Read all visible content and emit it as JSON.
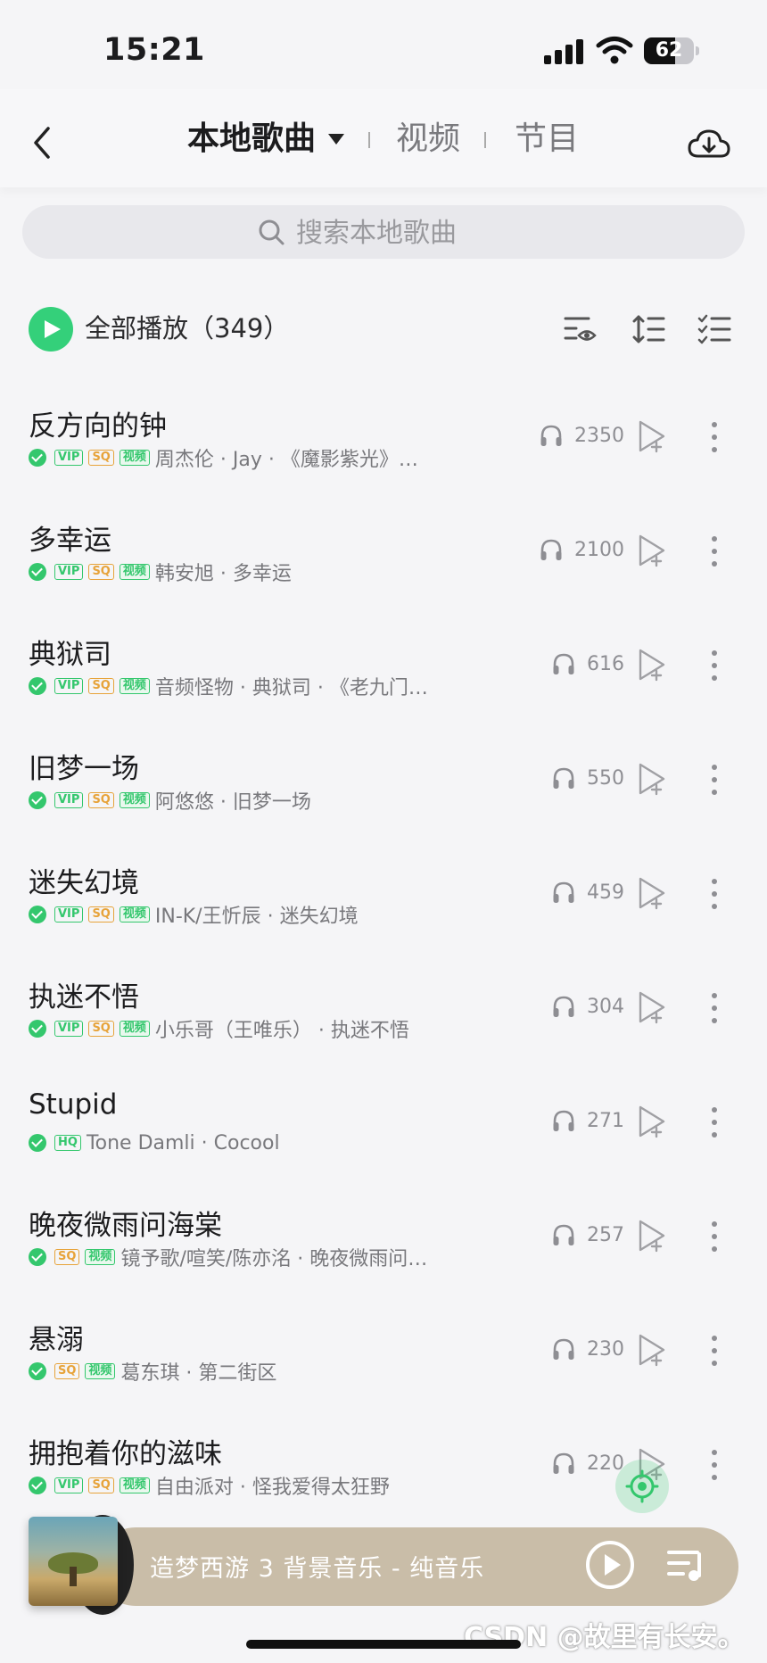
{
  "status": {
    "time": "15:21",
    "battery": "62",
    "battery_level": 0.62
  },
  "header": {
    "tabs": [
      {
        "label": "本地歌曲",
        "active": true
      },
      {
        "label": "视频",
        "active": false
      },
      {
        "label": "节目",
        "active": false
      }
    ],
    "icons": [
      "chevron-left-icon",
      "cloud-download-icon"
    ]
  },
  "search": {
    "placeholder": "搜索本地歌曲"
  },
  "toolbar": {
    "play_all_label": "全部播放（349）"
  },
  "songs": [
    {
      "title": "反方向的钟",
      "badges": [
        "VIP",
        "SQ",
        "视频"
      ],
      "subtitle": "周杰伦 · Jay · 《魔影紫光》…",
      "plays": "2350"
    },
    {
      "title": "多幸运",
      "badges": [
        "VIP",
        "SQ",
        "视频"
      ],
      "subtitle": "韩安旭 · 多幸运",
      "plays": "2100"
    },
    {
      "title": "典狱司",
      "badges": [
        "VIP",
        "SQ",
        "视频"
      ],
      "subtitle": "音频怪物 · 典狱司 · 《老九门…",
      "plays": "616"
    },
    {
      "title": "旧梦一场",
      "badges": [
        "VIP",
        "SQ",
        "视频"
      ],
      "subtitle": "阿悠悠 · 旧梦一场",
      "plays": "550"
    },
    {
      "title": "迷失幻境",
      "badges": [
        "VIP",
        "SQ",
        "视频"
      ],
      "subtitle": "IN-K/王忻辰 · 迷失幻境",
      "plays": "459"
    },
    {
      "title": "执迷不悟",
      "badges": [
        "VIP",
        "SQ",
        "视频"
      ],
      "subtitle": "小乐哥（王唯乐） · 执迷不悟",
      "plays": "304"
    },
    {
      "title": "Stupid",
      "badges": [
        "HQ"
      ],
      "subtitle": "Tone Damli · Cocool",
      "plays": "271"
    },
    {
      "title": "晚夜微雨问海棠",
      "badges": [
        "SQ",
        "视频"
      ],
      "subtitle": "镜予歌/喧笑/陈亦洺 · 晚夜微雨问…",
      "plays": "257"
    },
    {
      "title": "悬溺",
      "badges": [
        "SQ",
        "视频"
      ],
      "subtitle": "葛东琪 · 第二街区",
      "plays": "230"
    },
    {
      "title": "拥抱着你的滋味",
      "badges": [
        "VIP",
        "SQ",
        "视频"
      ],
      "subtitle": "自由派对 · 怪我爱得太狂野",
      "plays": "220"
    }
  ],
  "player": {
    "now_playing": "造梦西游 3 背景音乐 - 纯音乐"
  },
  "watermark": "CSDN @故里有长安。",
  "colors": {
    "accent": "#34c76d",
    "sq": "#e7a33a",
    "player_bg": "#c9bda8"
  }
}
